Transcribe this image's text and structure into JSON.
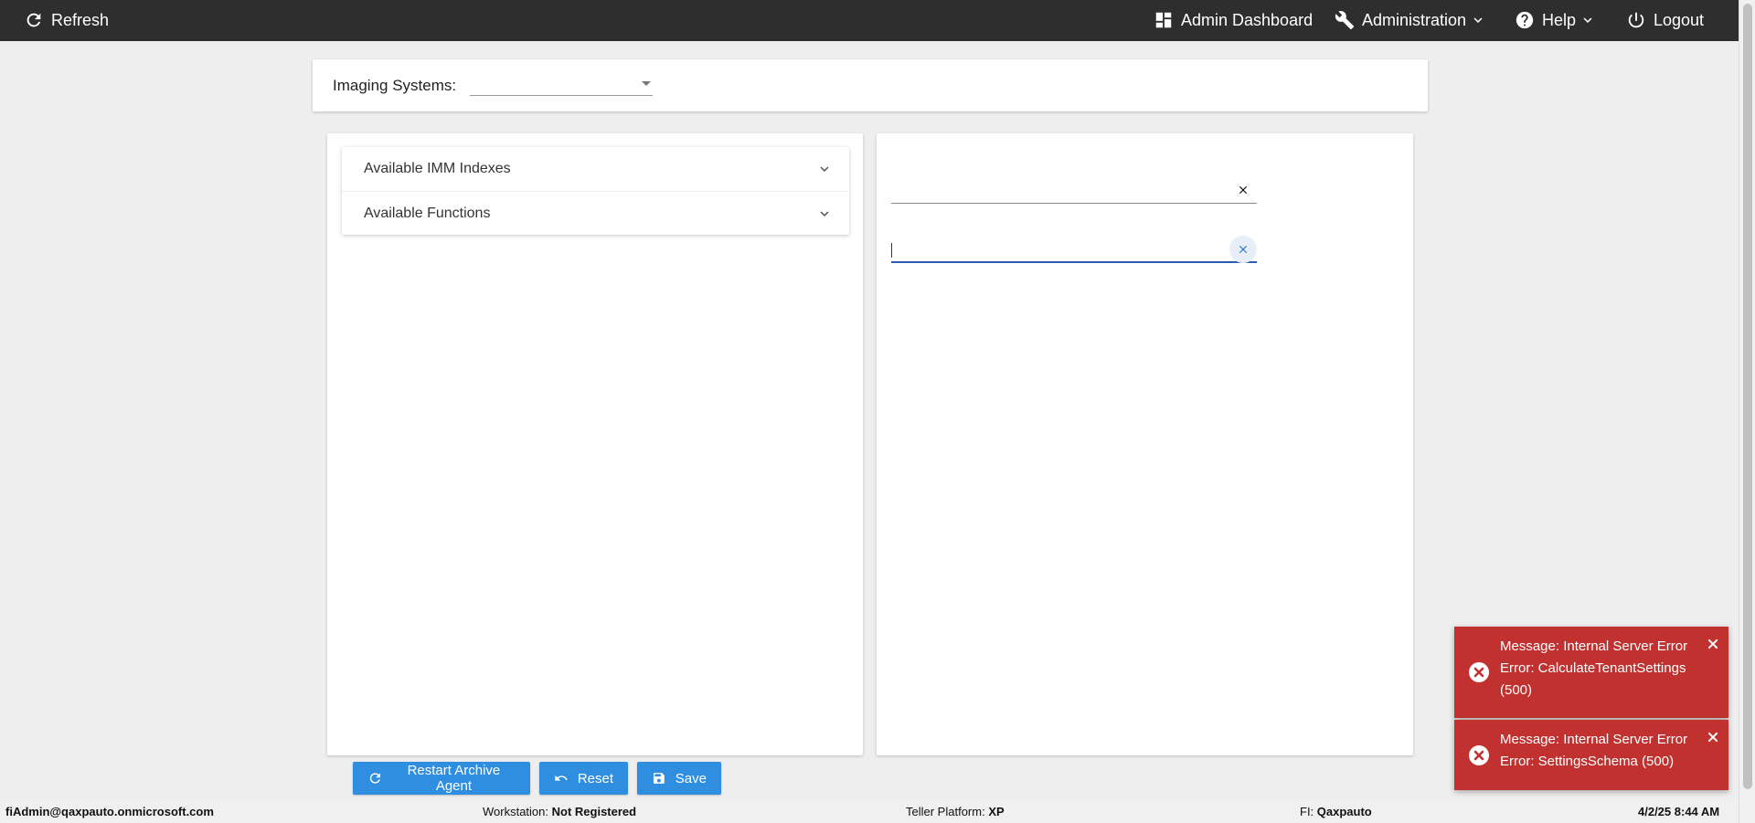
{
  "topbar": {
    "refresh_label": "Refresh",
    "admin_dashboard_label": "Admin Dashboard",
    "administration_label": "Administration",
    "help_label": "Help",
    "logout_label": "Logout"
  },
  "imaging": {
    "label": "Imaging Systems:",
    "selected_value": ""
  },
  "accordion": {
    "items": [
      {
        "label": "Available IMM Indexes"
      },
      {
        "label": "Available Functions"
      }
    ]
  },
  "fields": [
    {
      "value": ""
    },
    {
      "value": ""
    }
  ],
  "actions": {
    "restart_label": "Restart Archive Agent",
    "reset_label": "Reset",
    "save_label": "Save"
  },
  "footer": {
    "user": "fiAdmin@qaxpauto.onmicrosoft.com",
    "workstation_label": "Workstation:",
    "workstation_value": "Not Registered",
    "teller_label": "Teller Platform:",
    "teller_value": "XP",
    "fi_label": "FI:",
    "fi_value": "Qaxpauto",
    "datetime": "4/2/25 8:44 AM"
  },
  "toasts": [
    {
      "message": "Message: Internal Server Error Error: CalculateTenantSettings (500)"
    },
    {
      "message": "Message: Internal Server Error Error: SettingsSchema (500)"
    }
  ],
  "colors": {
    "topbar_bg": "#2e2e2e",
    "primary_button": "#2f8ee0",
    "error_toast": "#c0312f",
    "focus_underline": "#2a5db0"
  }
}
